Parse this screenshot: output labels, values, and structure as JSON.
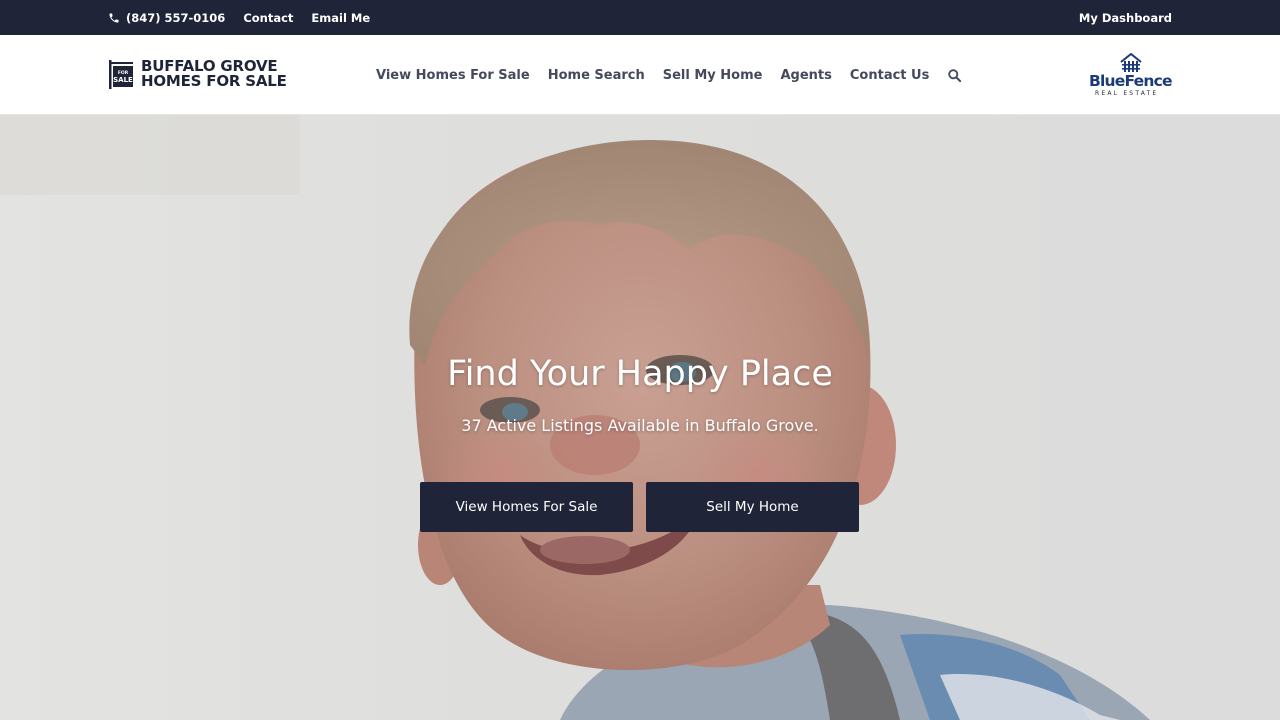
{
  "topbar": {
    "phone": "(847) 557-0106",
    "contact": "Contact",
    "email": "Email Me",
    "dashboard": "My Dashboard",
    "phone_icon": "phone-icon"
  },
  "logo": {
    "line1": "BUFFALO GROVE",
    "line2": "HOMES FOR SALE",
    "sign_text_top": "FOR",
    "sign_text": "SALE"
  },
  "nav": {
    "items": [
      "View Homes For Sale",
      "Home Search",
      "Sell My Home",
      "Agents",
      "Contact Us"
    ],
    "search_icon": "search-icon"
  },
  "brand": {
    "name": "BlueFence",
    "sub": "REAL ESTATE"
  },
  "hero": {
    "title": "Find Your Happy Place",
    "subtitle": "37 Active Listings Available in Buffalo Grove.",
    "btn_view": "View Homes For Sale",
    "btn_sell": "Sell My Home"
  },
  "colors": {
    "navy": "#1f2438",
    "nav_text": "#444a5c",
    "brand_blue": "#1c3a78"
  }
}
